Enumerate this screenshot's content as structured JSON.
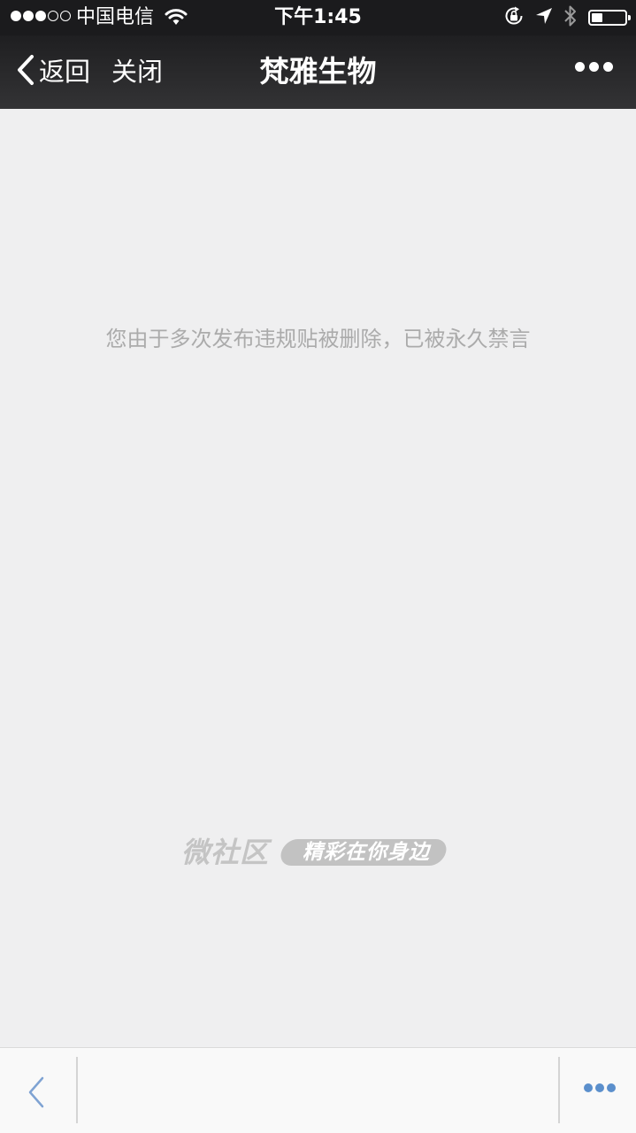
{
  "status_bar": {
    "carrier": "中国电信",
    "time": "下午1:45",
    "signal_filled": 3,
    "signal_total": 5,
    "battery_level": 0.33
  },
  "nav_bar": {
    "back_label": "返回",
    "close_label": "关闭",
    "title": "梵雅生物"
  },
  "content": {
    "message": "您由于多次发布违规贴被删除，已被永久禁言"
  },
  "brand": {
    "name": "微社区",
    "slogan": "精彩在你身边"
  },
  "icons": {
    "back": "chevron-left-icon",
    "more": "more-dots-icon",
    "wifi": "wifi-icon",
    "rotation_lock": "rotation-lock-icon",
    "location": "location-arrow-icon",
    "bluetooth": "bluetooth-icon",
    "battery": "battery-icon"
  },
  "colors": {
    "status_bar_bg": "#1b1b1d",
    "nav_bar_bg": "#2a2a2c",
    "page_bg": "#efeff0",
    "message_text": "#ababab",
    "toolbar_accent": "#5b8fcc"
  }
}
